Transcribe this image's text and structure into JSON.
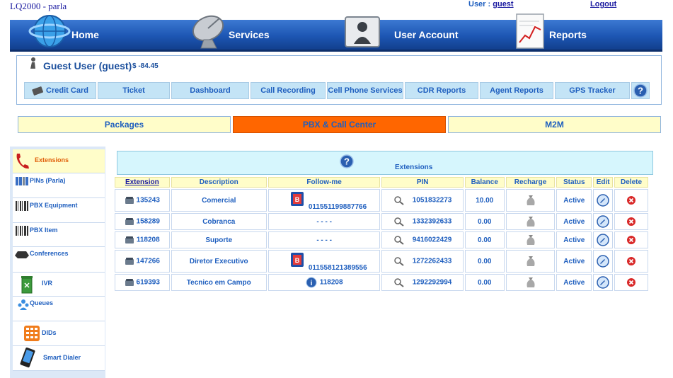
{
  "header": {
    "app_title": "LQ2000 - parla",
    "user_label": "User :",
    "user_name": "guest",
    "logout": "Logout"
  },
  "nav": [
    {
      "label": "Home",
      "icon": "globe-icon"
    },
    {
      "label": "Services",
      "icon": "satellite-dish-icon"
    },
    {
      "label": "User Account",
      "icon": "folder-user-icon"
    },
    {
      "label": "Reports",
      "icon": "report-chart-icon"
    }
  ],
  "account": {
    "name": "Guest User (guest)",
    "balance": "$ -84.45"
  },
  "subtabs": [
    "Credit Card",
    "Ticket",
    "Dashboard",
    "Call Recording",
    "Cell Phone Services",
    "CDR Reports",
    "Agent Reports",
    "GPS Tracker"
  ],
  "section_tabs": [
    "Packages",
    "PBX & Call Center",
    "M2M"
  ],
  "sidebar": [
    "Extensions",
    "PINs (Parla)",
    "PBX Equipment",
    "PBX Item",
    "Conferences",
    "IVR",
    "Queues",
    "DIDs",
    "Smart Dialer"
  ],
  "content_title": "Extensions",
  "columns": [
    "Extension",
    "Description",
    "Follow-me",
    "PIN",
    "Balance",
    "Recharge",
    "Status",
    "Edit",
    "Delete"
  ],
  "rows": [
    {
      "ext": "135243",
      "desc": "Comercial",
      "follow": "011551199887766",
      "pin": "1051832273",
      "balance": "10.00",
      "status": "Active"
    },
    {
      "ext": "158289",
      "desc": "Cobranca",
      "follow": "- - - -",
      "pin": "1332392633",
      "balance": "0.00",
      "status": "Active"
    },
    {
      "ext": "118208",
      "desc": "Suporte",
      "follow": "- - - -",
      "pin": "9416022429",
      "balance": "0.00",
      "status": "Active"
    },
    {
      "ext": "147266",
      "desc": "Diretor Executivo",
      "follow": "011558121389556",
      "pin": "1272262433",
      "balance": "0.00",
      "status": "Active"
    },
    {
      "ext": "619393",
      "desc": "Tecnico em Campo",
      "follow": "118208",
      "pin": "1292292994",
      "balance": "0.00",
      "status": "Active"
    }
  ]
}
